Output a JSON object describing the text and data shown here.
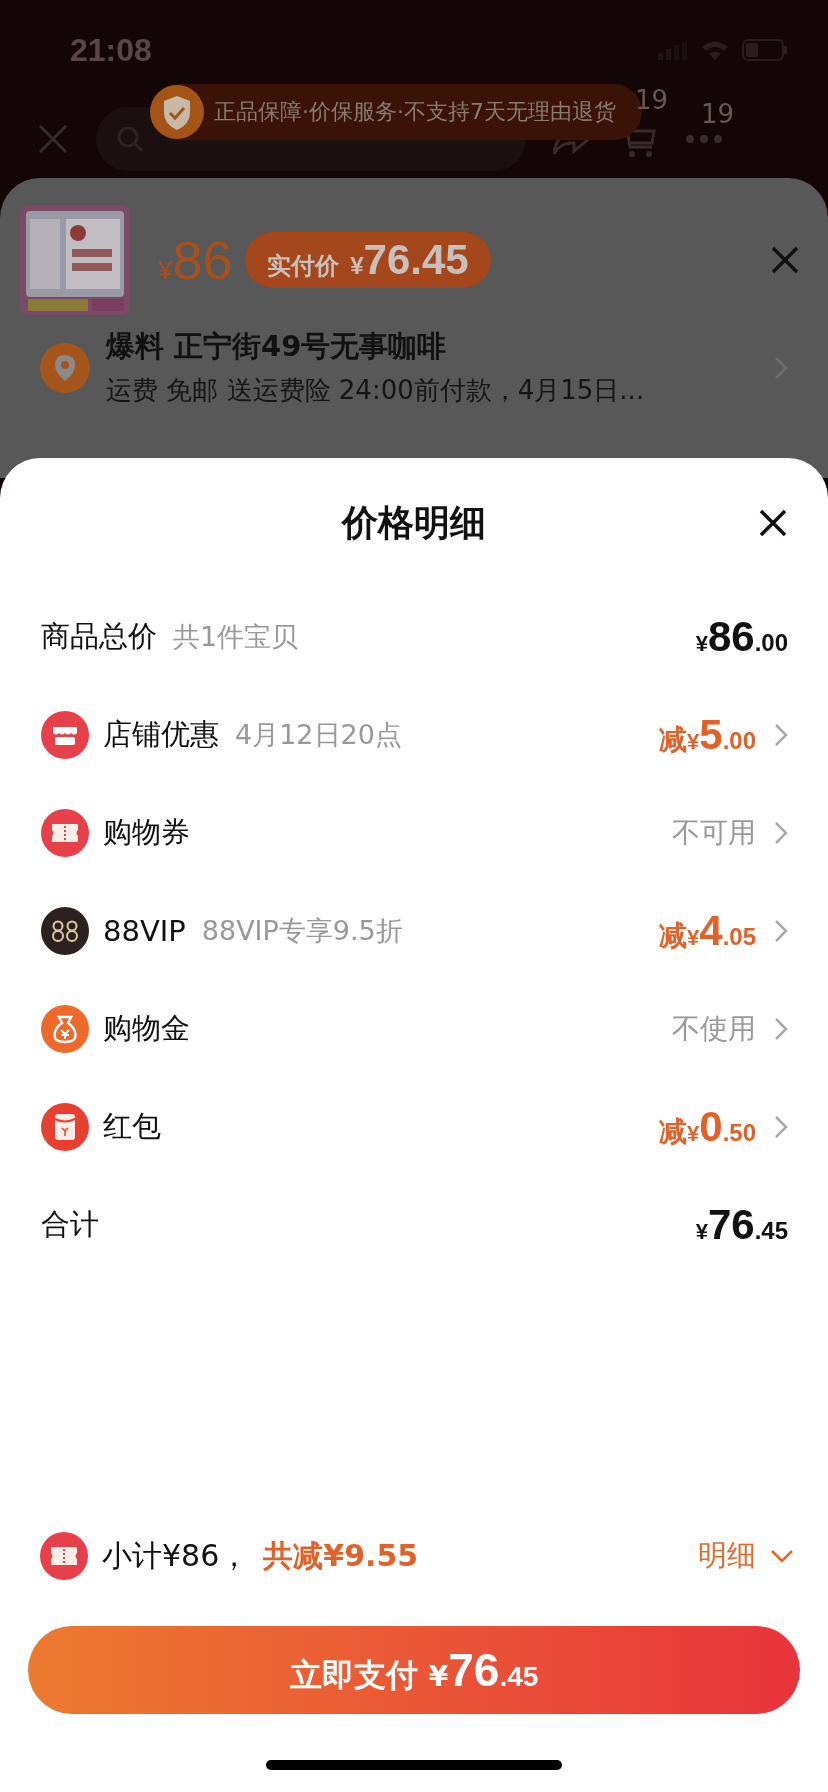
{
  "status_bar": {
    "time": "21:08"
  },
  "toast": {
    "text": "正品保障·价保服务·不支持7天无理由退货"
  },
  "nav": {
    "cart_badge": "19",
    "more_badge": "19"
  },
  "product": {
    "price_symbol": "¥",
    "price": "86",
    "actual_label": "实付价",
    "actual_symbol": "¥",
    "actual_price": "76.45"
  },
  "address": {
    "title": "爆料 正宁街49号无事咖啡",
    "detail": "运费 免邮 送运费险 24:00前付款，4月15日..."
  },
  "sheet": {
    "title": "价格明细"
  },
  "rows": [
    {
      "kind": "amount",
      "label": "商品总价",
      "note": "共1件宝贝",
      "amount": {
        "symbol": "¥",
        "int": "86",
        "dec": ".00"
      }
    },
    {
      "kind": "discount",
      "label": "店铺优惠",
      "note": "4月12日20点",
      "amount": {
        "prefix": "减",
        "symbol": "¥",
        "int": "5",
        "dec": ".00"
      }
    },
    {
      "kind": "status",
      "label": "购物券",
      "status": "不可用"
    },
    {
      "kind": "discount",
      "label": "88VIP",
      "note": "88VIP专享9.5折",
      "amount": {
        "prefix": "减",
        "symbol": "¥",
        "int": "4",
        "dec": ".05"
      }
    },
    {
      "kind": "status",
      "label": "购物金",
      "status": "不使用"
    },
    {
      "kind": "discount",
      "label": "红包",
      "amount": {
        "prefix": "减",
        "symbol": "¥",
        "int": "0",
        "dec": ".50"
      }
    },
    {
      "kind": "amount",
      "label": "合计",
      "amount": {
        "symbol": "¥",
        "int": "76",
        "dec": ".45"
      }
    }
  ],
  "footer": {
    "subtotal": "小计¥86，",
    "saved": "共减¥9.55",
    "details": "明细"
  },
  "pay_button": {
    "label": "立即支付",
    "symbol": "¥",
    "int": "76",
    "dec": ".45"
  }
}
